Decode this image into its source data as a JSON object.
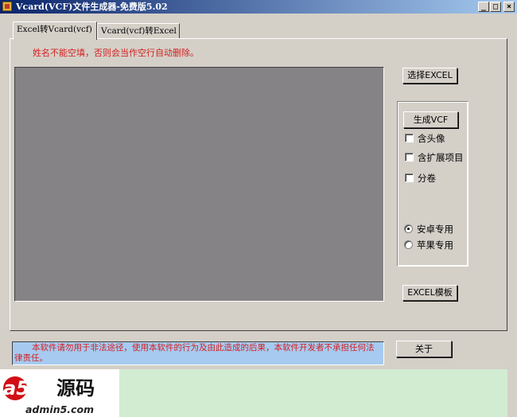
{
  "window": {
    "title": "Vcard(VCF)文件生成器-免费版5.02",
    "controls": {
      "minimize": "_",
      "maximize": "□",
      "close": "×"
    }
  },
  "tabs": [
    {
      "label": "Excel转Vcard(vcf)",
      "selected": true
    },
    {
      "label": "Vcard(vcf)转Excel",
      "selected": false
    }
  ],
  "main": {
    "name_warning": "姓名不能空填，否则会当作空行自动删除。",
    "select_excel_label": "选择EXCEL",
    "generate_vcf_label": "生成VCF",
    "excel_template_label": "EXCEL模板",
    "options": [
      {
        "label": "含头像",
        "checked": false
      },
      {
        "label": "含扩展项目",
        "checked": false
      },
      {
        "label": "分卷",
        "checked": false
      }
    ],
    "platforms": [
      {
        "label": "安卓专用",
        "selected": true
      },
      {
        "label": "苹果专用",
        "selected": false
      }
    ]
  },
  "footer": {
    "disclaimer": "本软件请勿用于非法途径，使用本软件的行为及由此造成的后果，本软件开发者不承担任何法律责任。",
    "about_label": "关于",
    "logo": {
      "mark": "a5",
      "cn_text": "源码",
      "site": "admin5.com"
    }
  },
  "colors": {
    "face": "#d4d0c8",
    "title_gradient_start": "#0a246a",
    "warning_red": "#d42020",
    "preview_gray": "#858386",
    "disclaimer_bg": "#a6caf0",
    "footer_bg": "#d2ecd2",
    "logo_red": "#d10e14"
  }
}
